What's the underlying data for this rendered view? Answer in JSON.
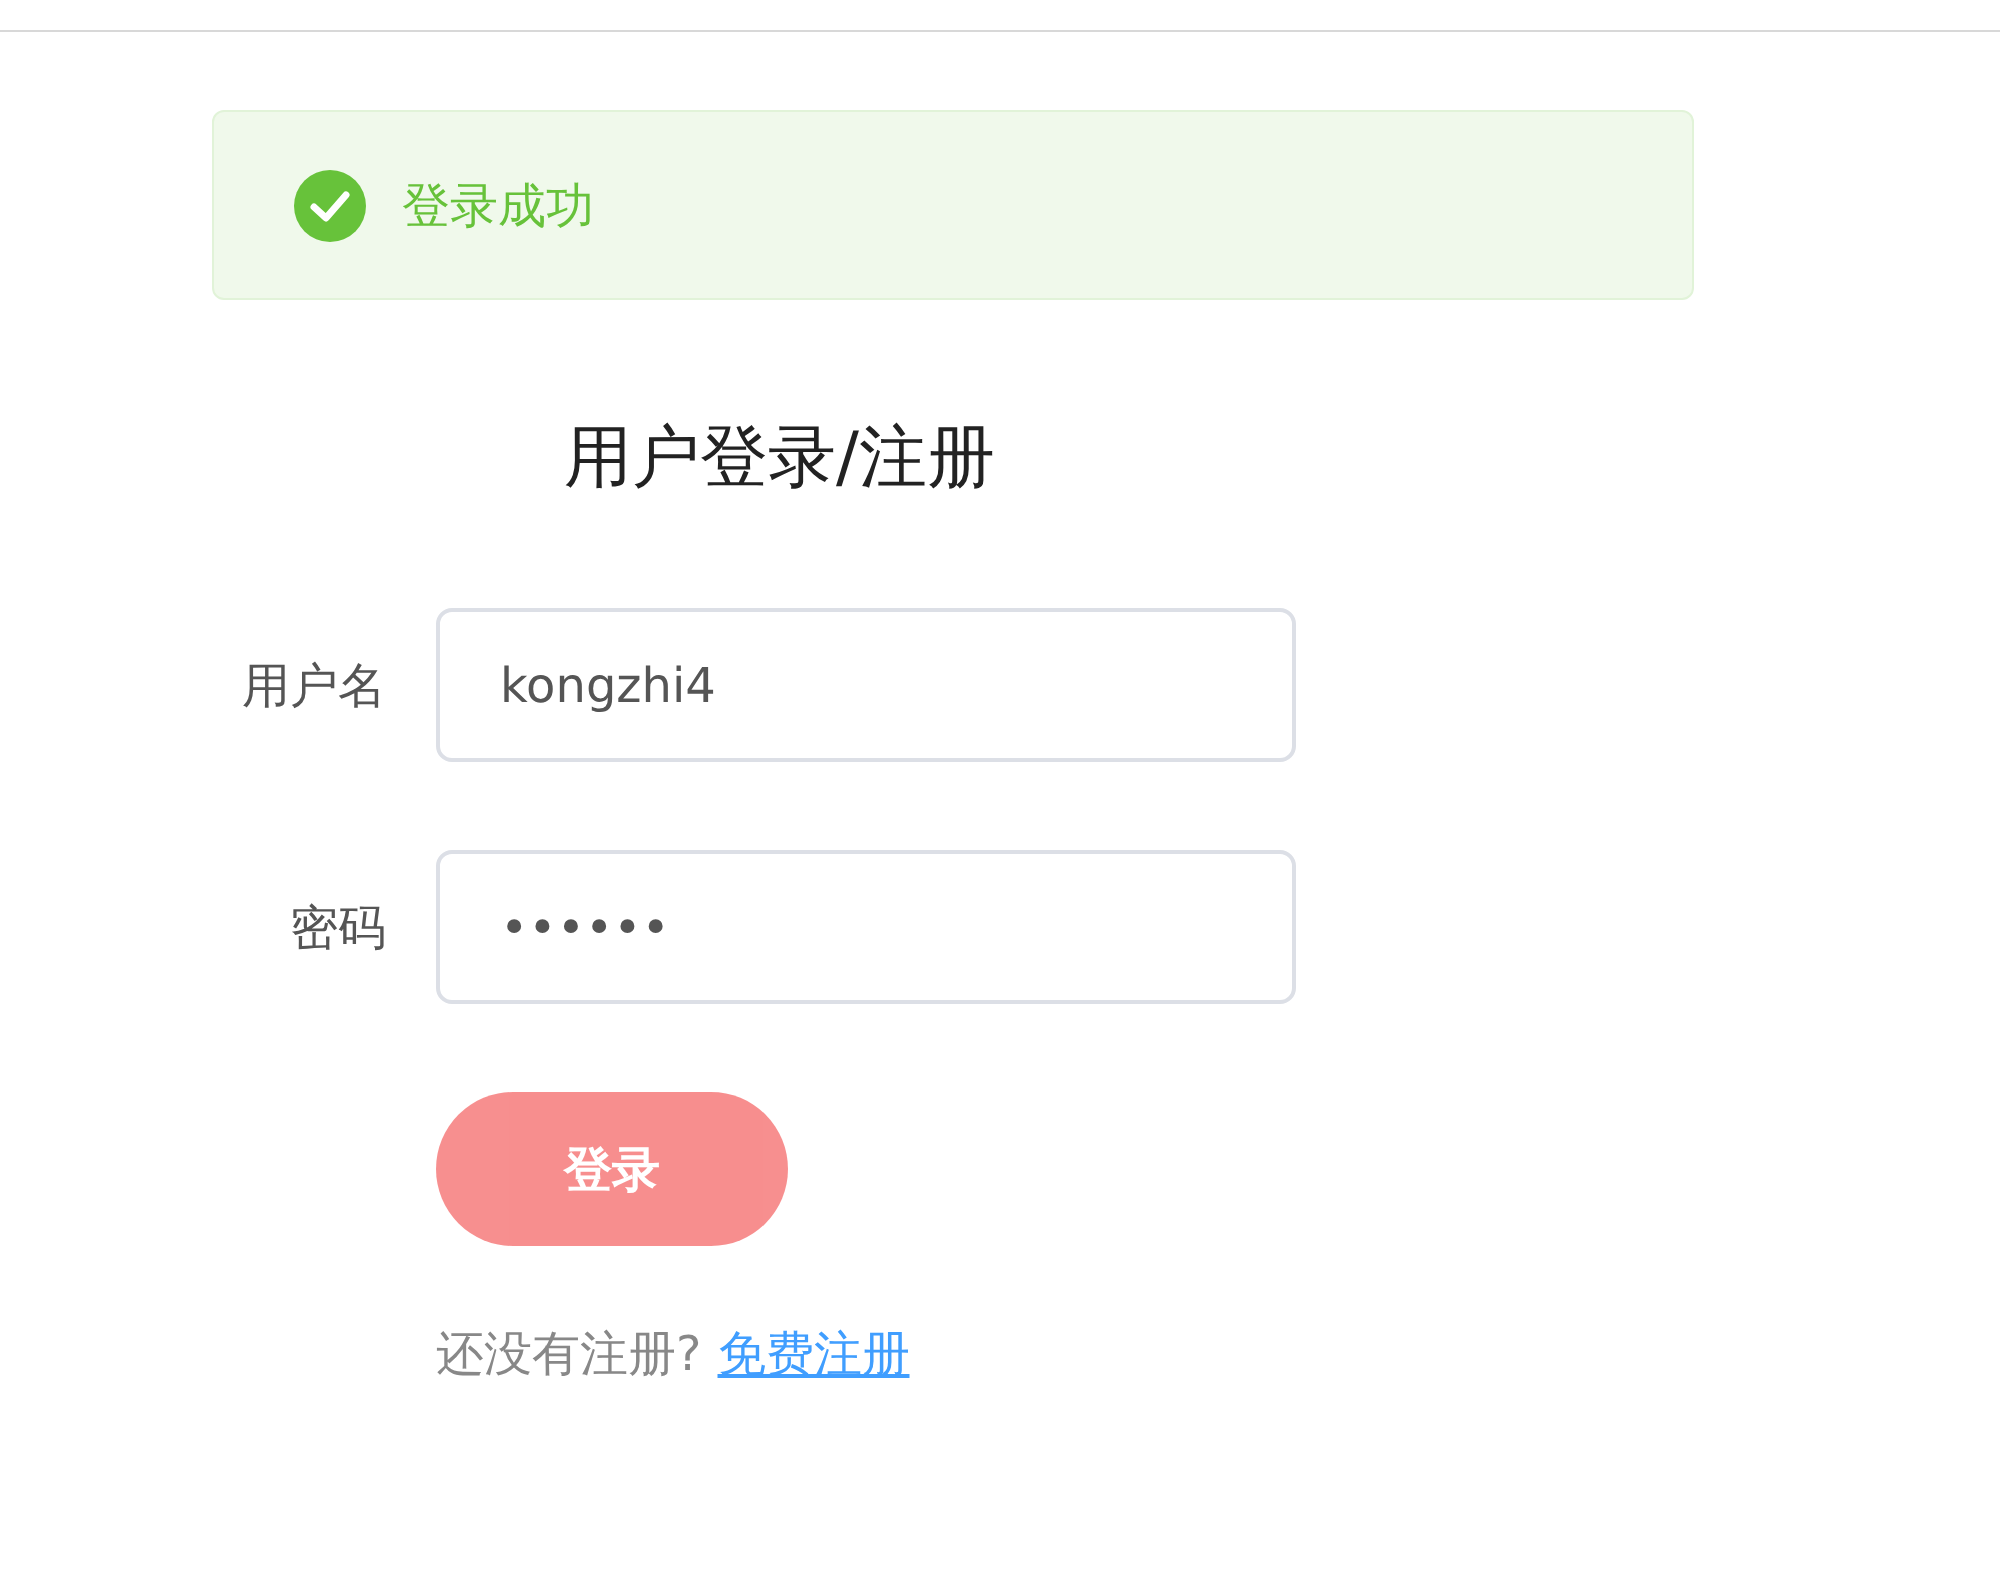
{
  "alert": {
    "success": true,
    "message": "登录成功"
  },
  "title": "用户登录/注册",
  "fields": [
    {
      "label": "用户名",
      "value": "kongzhi4"
    },
    {
      "label": "密码",
      "value": "••••••"
    }
  ],
  "submit_button": {
    "label": "登录",
    "disabled": true
  },
  "footer": {
    "text": "还没有注册?",
    "link": "免费注册"
  }
}
